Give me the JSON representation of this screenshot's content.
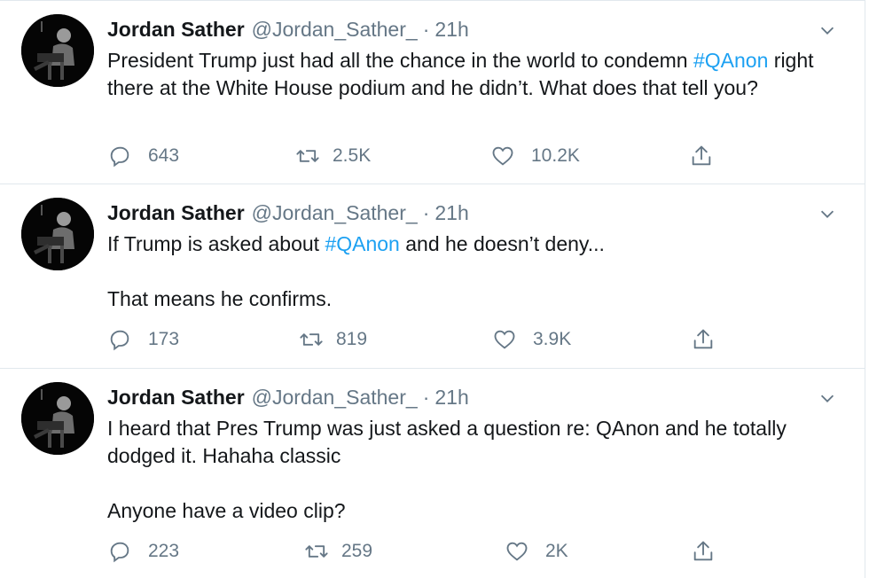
{
  "tweets": [
    {
      "name": "Jordan Sather",
      "handle": "@Jordan_Sather_",
      "separator": "·",
      "time": "21h",
      "text_parts": [
        "President Trump just had all the chance in the world to condemn ",
        "#QAnon",
        " right there at the White House podium and he didn’t. What does that tell you?"
      ],
      "replies": "643",
      "retweets": "2.5K",
      "likes": "10.2K"
    },
    {
      "name": "Jordan Sather",
      "handle": "@Jordan_Sather_",
      "separator": "·",
      "time": "21h",
      "text_parts": [
        "If Trump is asked about ",
        "#QAnon",
        " and he doesn’t deny..."
      ],
      "text_line2": "That means he confirms.",
      "replies": "173",
      "retweets": "819",
      "likes": "3.9K"
    },
    {
      "name": "Jordan Sather",
      "handle": "@Jordan_Sather_",
      "separator": "·",
      "time": "21h",
      "text_line1": "I heard that Pres Trump was just asked a question re: QAnon and he totally dodged it. Hahaha classic",
      "text_line2": "Anyone have a video clip?",
      "replies": "223",
      "retweets": "259",
      "likes": "2K"
    }
  ],
  "icons": {
    "reply": "reply-icon",
    "retweet": "retweet-icon",
    "like": "heart-icon",
    "share": "share-icon",
    "caret": "chevron-down-icon"
  },
  "colors": {
    "text": "#14171a",
    "muted": "#657786",
    "link": "#1da1f2",
    "divider": "#e1e8ed"
  }
}
